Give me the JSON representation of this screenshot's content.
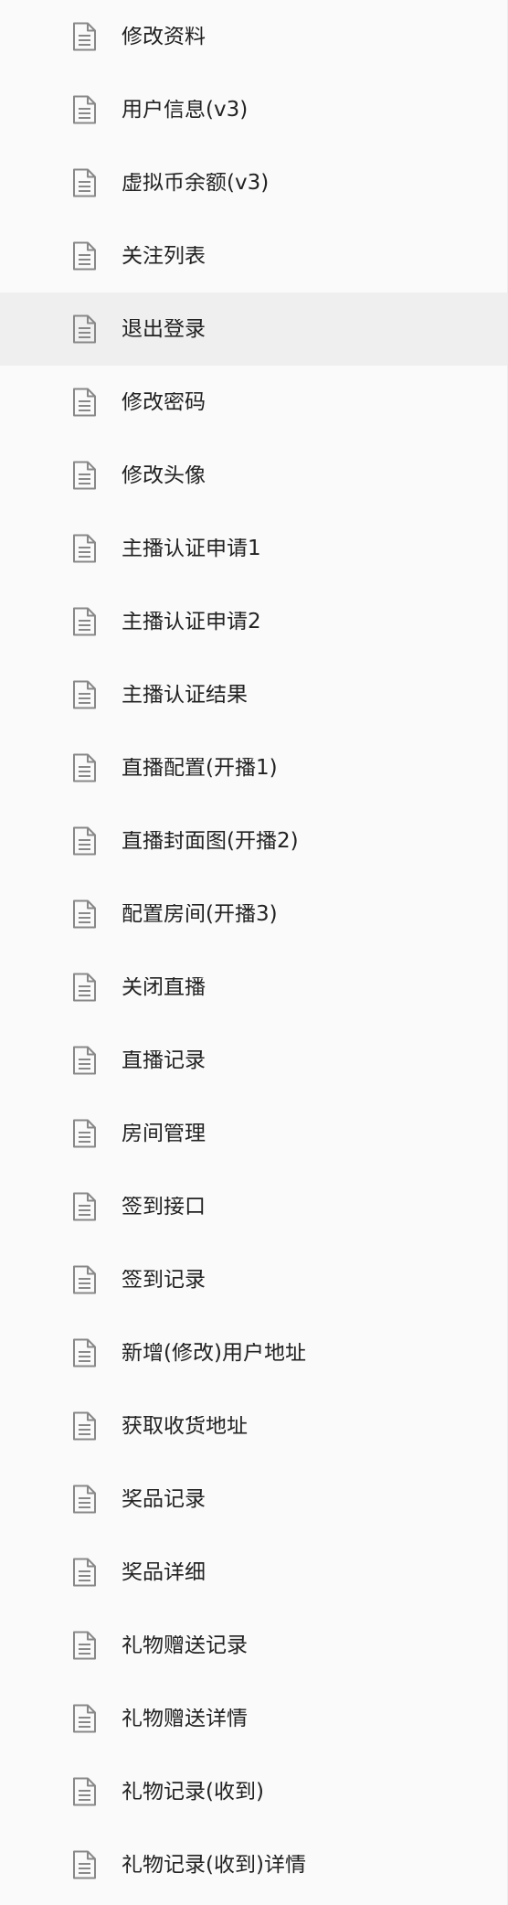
{
  "sidebar": {
    "active_index": 4,
    "icon_name": "document-icon",
    "icon_color": "#888888",
    "text_color": "#222222",
    "active_background": "#efefef",
    "items": [
      {
        "label": "修改资料"
      },
      {
        "label": "用户信息(v3)"
      },
      {
        "label": "虚拟币余额(v3)"
      },
      {
        "label": "关注列表"
      },
      {
        "label": "退出登录"
      },
      {
        "label": "修改密码"
      },
      {
        "label": "修改头像"
      },
      {
        "label": "主播认证申请1"
      },
      {
        "label": "主播认证申请2"
      },
      {
        "label": "主播认证结果"
      },
      {
        "label": "直播配置(开播1)"
      },
      {
        "label": "直播封面图(开播2)"
      },
      {
        "label": "配置房间(开播3)"
      },
      {
        "label": "关闭直播"
      },
      {
        "label": "直播记录"
      },
      {
        "label": "房间管理"
      },
      {
        "label": "签到接口"
      },
      {
        "label": "签到记录"
      },
      {
        "label": "新增(修改)用户地址"
      },
      {
        "label": "获取收货地址"
      },
      {
        "label": "奖品记录"
      },
      {
        "label": "奖品详细"
      },
      {
        "label": "礼物赠送记录"
      },
      {
        "label": "礼物赠送详情"
      },
      {
        "label": "礼物记录(收到)"
      },
      {
        "label": "礼物记录(收到)详情"
      }
    ]
  }
}
